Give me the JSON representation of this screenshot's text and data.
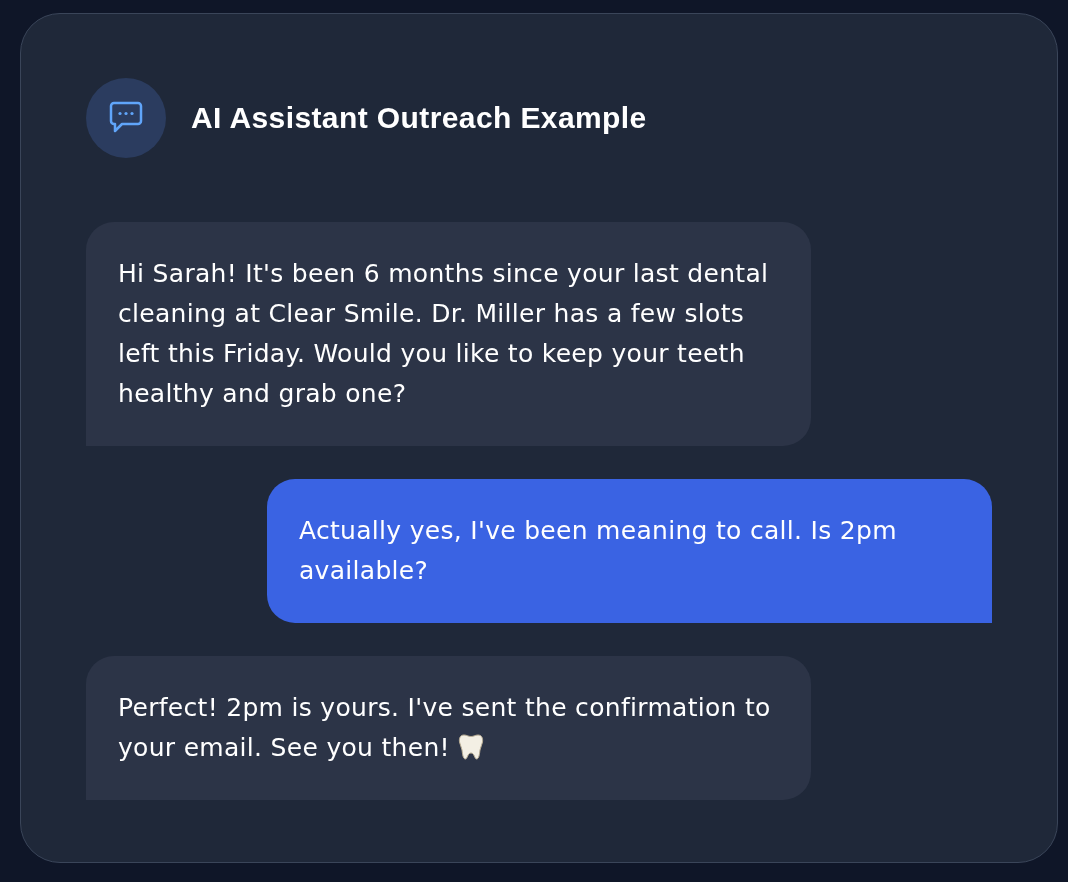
{
  "header": {
    "title": "AI Assistant Outreach Example"
  },
  "messages": [
    {
      "kind": "incoming",
      "text": "Hi Sarah! It's been 6 months since your last dental cleaning at Clear Smile. Dr. Miller has a few slots left this Friday. Would you like to keep your teeth healthy and grab one?"
    },
    {
      "kind": "outgoing",
      "text": "Actually yes, I've been meaning to call. Is 2pm available?"
    },
    {
      "kind": "incoming",
      "text": "Perfect! 2pm is yours. I've sent the confirmation to your email. See you then!",
      "tooth_icon": true
    }
  ]
}
